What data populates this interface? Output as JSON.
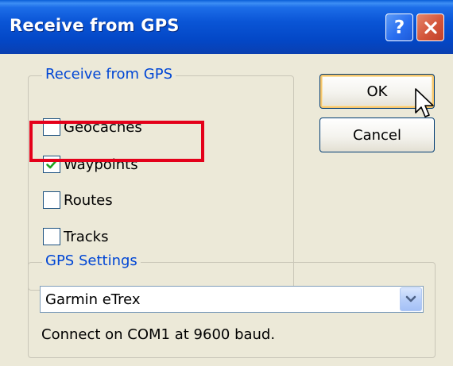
{
  "window": {
    "title": "Receive from GPS",
    "help_icon": "question-mark-icon",
    "close_icon": "close-x-icon"
  },
  "receive_group": {
    "label": "Receive from GPS",
    "items": [
      {
        "label": "Geocaches",
        "checked": false
      },
      {
        "label": "Waypoints",
        "checked": true
      },
      {
        "label": "Routes",
        "checked": false
      },
      {
        "label": "Tracks",
        "checked": false
      }
    ]
  },
  "buttons": {
    "ok_label": "OK",
    "cancel_label": "Cancel"
  },
  "gps_group": {
    "label": "GPS Settings",
    "device_selected": "Garmin eTrex",
    "status": "Connect on COM1 at 9600 baud."
  },
  "annotation": {
    "highlight_color": "#e4001a",
    "highlight_target": "Waypoints"
  },
  "colors": {
    "title_bar": "#0a55d6",
    "group_label": "#0046d5",
    "dialog_bg": "#ece9d8",
    "checkmark": "#21a121"
  }
}
